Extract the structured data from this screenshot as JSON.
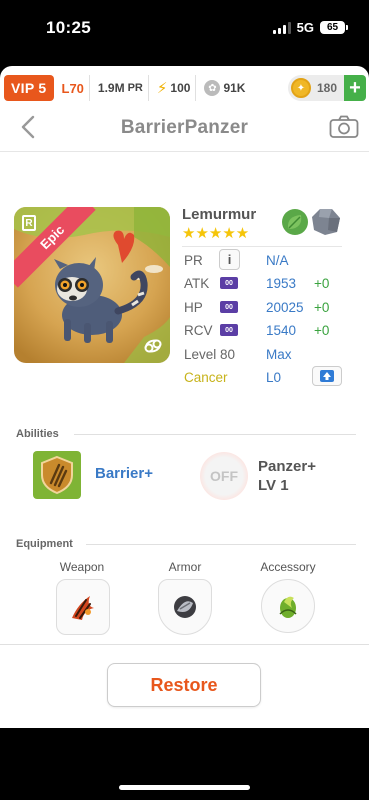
{
  "status_bar": {
    "time": "10:25",
    "network": "5G",
    "battery": "65"
  },
  "resources": {
    "vip": "VIP 5",
    "level": "L70",
    "power": "1.9M",
    "power_unit": "PR",
    "energy": "100",
    "food": "91K",
    "coins": "180"
  },
  "header": {
    "title": "BarrierPanzer"
  },
  "creature": {
    "name": "Lemurmur",
    "stars": "★★★★★",
    "rarity_letter": "R",
    "rarity": "Epic",
    "elements": [
      "leaf-icon",
      "rock-icon"
    ],
    "stats": {
      "pr_label": "PR",
      "pr_value": "N/A",
      "atk_label": "ATK",
      "atk_tag": "00",
      "atk_value": "1953",
      "atk_bonus": "+0",
      "hp_label": "HP",
      "hp_tag": "00",
      "hp_value": "20025",
      "hp_bonus": "+0",
      "rcv_label": "RCV",
      "rcv_tag": "00",
      "rcv_value": "1540",
      "rcv_bonus": "+0",
      "level_label": "Level 80",
      "level_value": "Max",
      "zodiac_label": "Cancer",
      "zodiac_value": "L0"
    }
  },
  "abilities": {
    "heading": "Abilities",
    "primary": "Barrier+",
    "secondary_badge": "OFF",
    "secondary_line1": "Panzer+",
    "secondary_line2": "LV 1"
  },
  "equipment": {
    "heading": "Equipment",
    "slots": [
      "Weapon",
      "Armor",
      "Accessory"
    ]
  },
  "actions": {
    "restore": "Restore"
  },
  "colors": {
    "accent": "#e8571c",
    "value_blue": "#3a7ac6",
    "bonus_green": "#3aa33f",
    "epic": "#e94c5f"
  }
}
